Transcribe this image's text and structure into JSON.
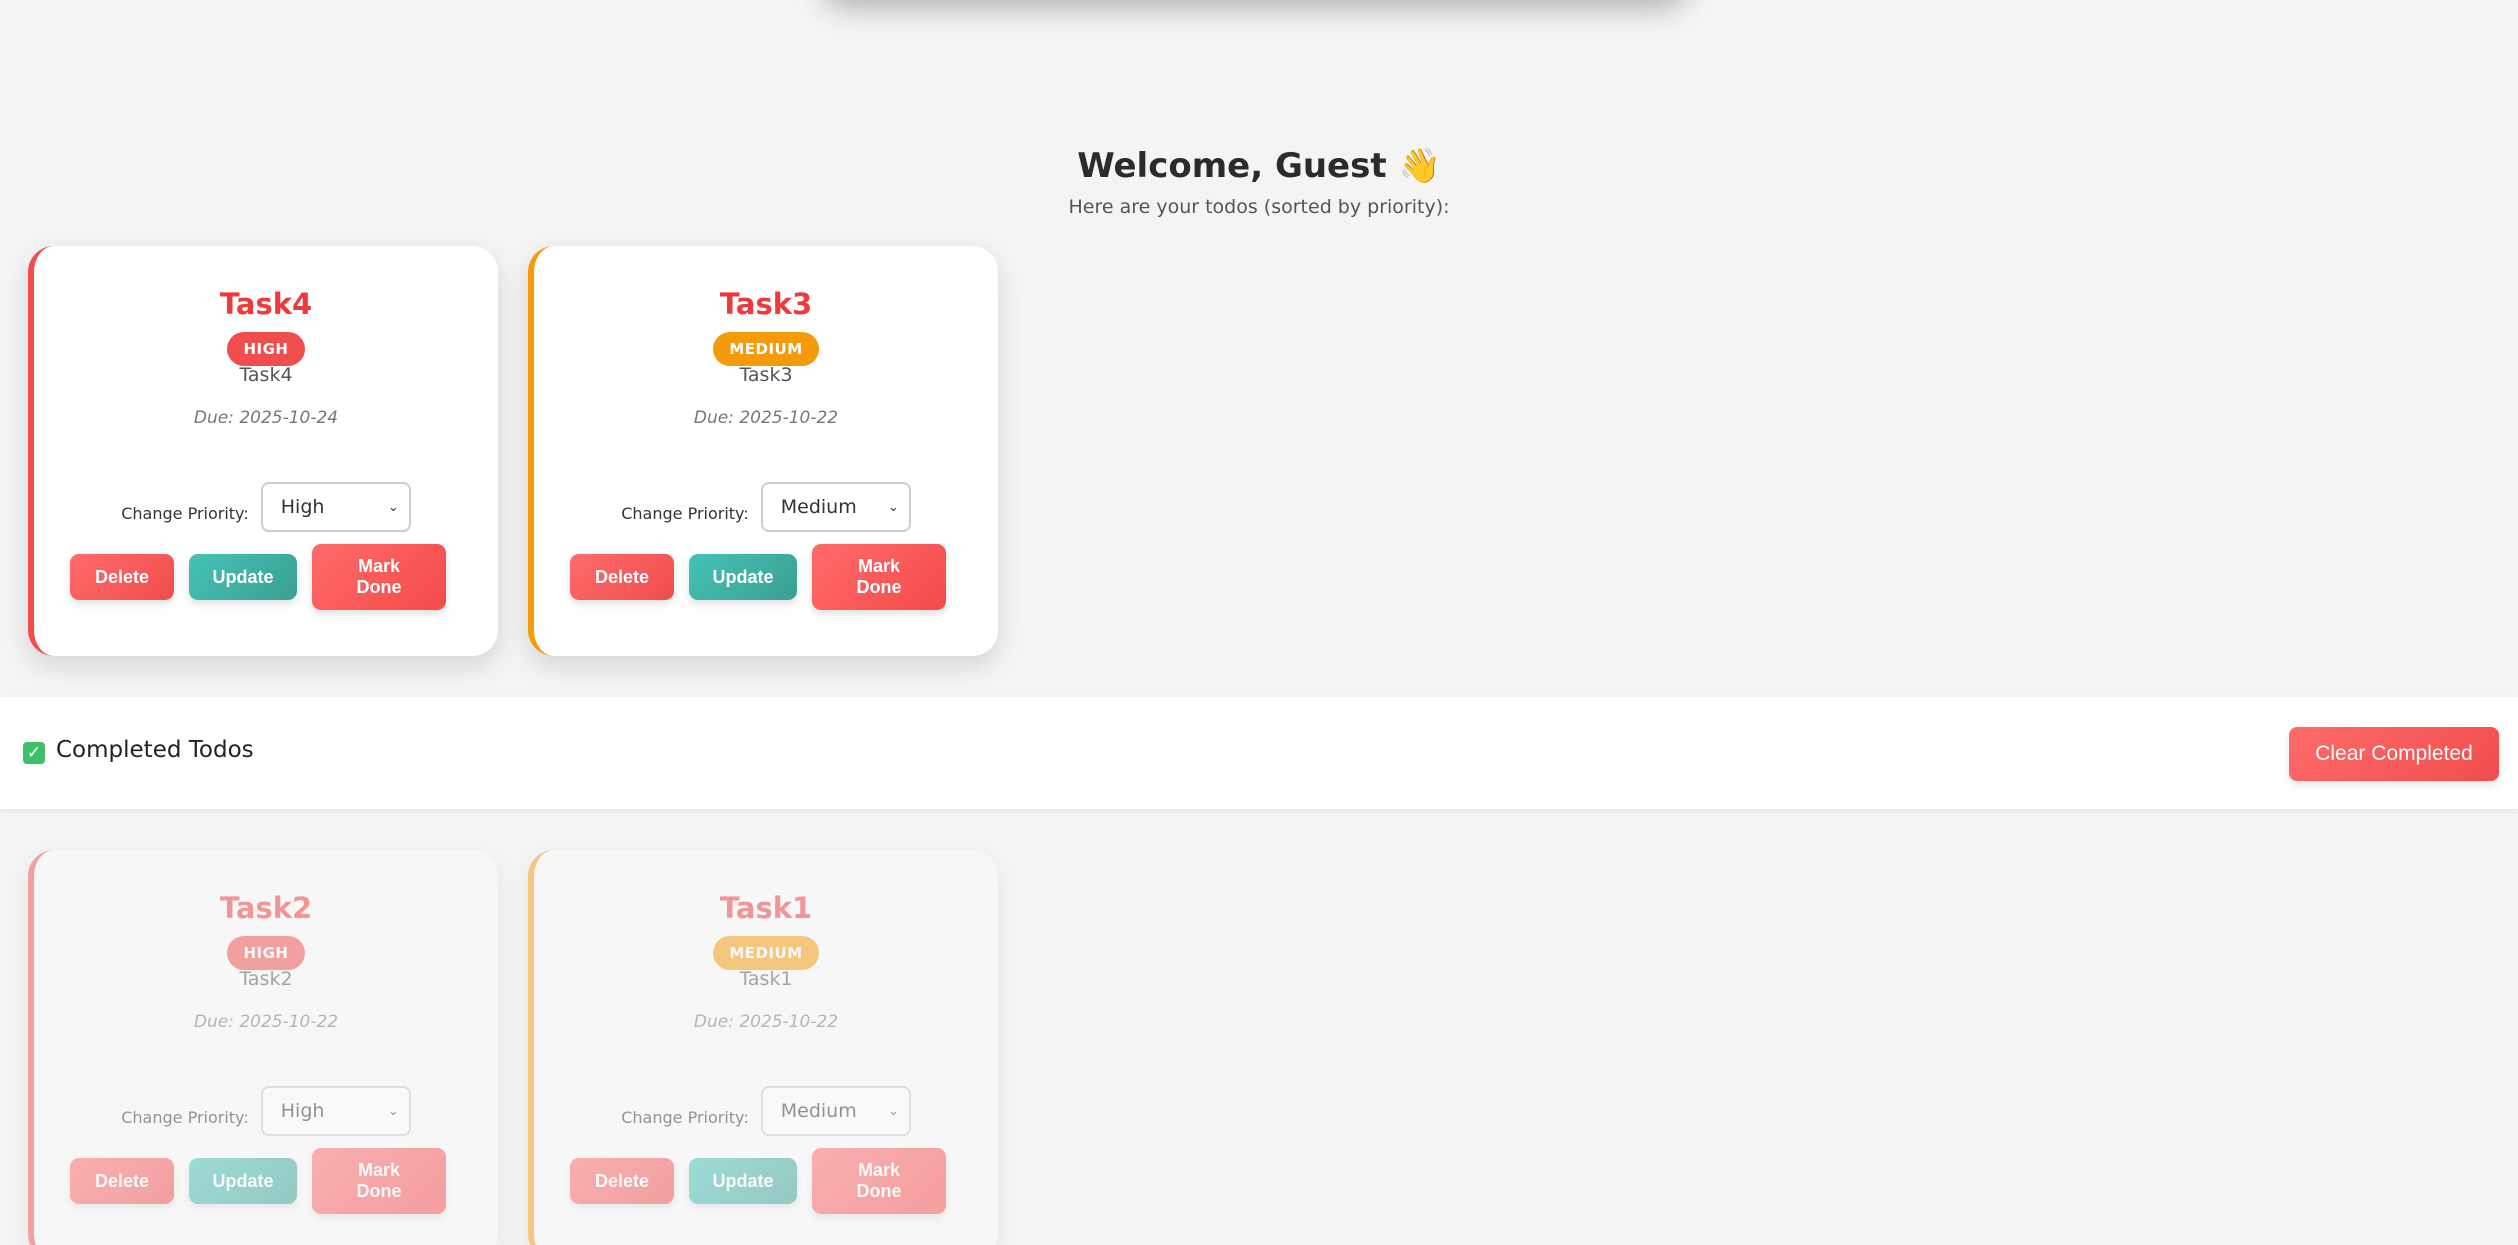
{
  "welcome": {
    "title": "Welcome, Guest",
    "wave_emoji": "👋",
    "subtitle": "Here are your todos (sorted by priority):"
  },
  "active_todos": [
    {
      "title": "Task4",
      "priority_badge": "HIGH",
      "description": "Task4",
      "due": "Due: 2025-10-24",
      "change_priority_label": "Change Priority:",
      "priority_value": "High",
      "delete_label": "Delete",
      "update_label": "Update",
      "mark_done_label": "Mark Done"
    },
    {
      "title": "Task3",
      "priority_badge": "MEDIUM",
      "description": "Task3",
      "due": "Due: 2025-10-22",
      "change_priority_label": "Change Priority:",
      "priority_value": "Medium",
      "delete_label": "Delete",
      "update_label": "Update",
      "mark_done_label": "Mark Done"
    }
  ],
  "completed_section": {
    "label": "Completed Todos",
    "check_icon": "✓",
    "clear_label": "Clear Completed"
  },
  "completed_todos": [
    {
      "title": "Task2",
      "priority_badge": "HIGH",
      "description": "Task2",
      "due": "Due: 2025-10-22",
      "change_priority_label": "Change Priority:",
      "priority_value": "High",
      "delete_label": "Delete",
      "update_label": "Update",
      "mark_done_label": "Mark Done"
    },
    {
      "title": "Task1",
      "priority_badge": "MEDIUM",
      "description": "Task1",
      "due": "Due: 2025-10-22",
      "change_priority_label": "Change Priority:",
      "priority_value": "Medium",
      "delete_label": "Delete",
      "update_label": "Update",
      "mark_done_label": "Mark Done"
    }
  ],
  "colors": {
    "high": "#f04d4d",
    "medium": "#f59a0b",
    "update": "#44c3b6",
    "completed_check": "#3fbf6a"
  },
  "icons": {
    "select_chevron": "chevron-down-icon",
    "wave": "wave-hand-icon",
    "completed": "checkbox-checked-icon"
  }
}
